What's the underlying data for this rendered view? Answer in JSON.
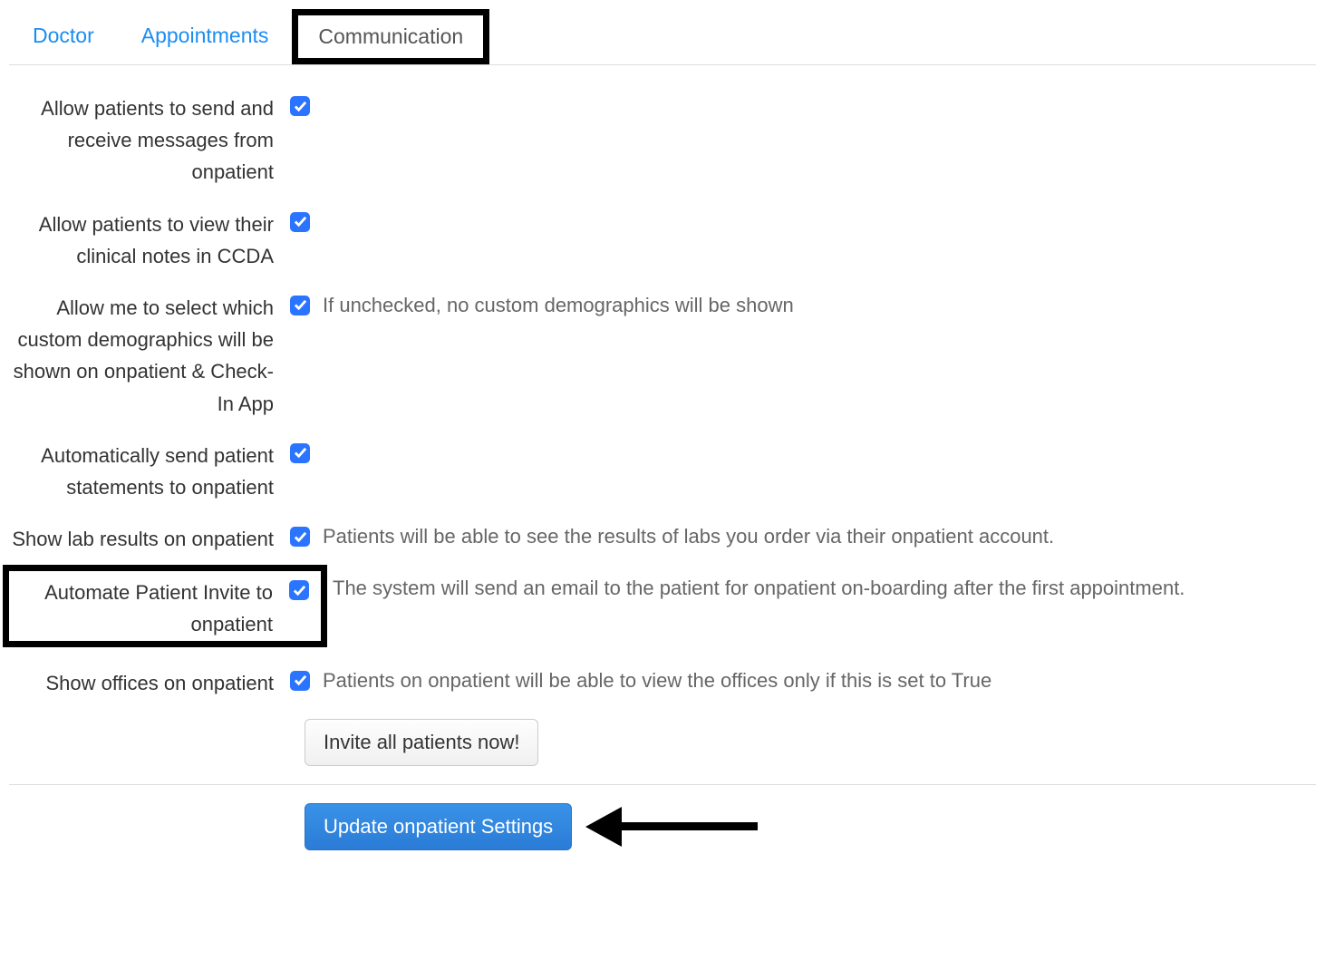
{
  "tabs": {
    "doctor": "Doctor",
    "appointments": "Appointments",
    "communication": "Communication"
  },
  "settings": {
    "allow_messages": {
      "label": "Allow patients to send and receive messages from onpatient",
      "checked": true
    },
    "allow_ccda": {
      "label": "Allow patients to view their clinical notes in CCDA",
      "checked": true
    },
    "custom_demographics": {
      "label": "Allow me to select which custom demographics will be shown on onpatient & Check-In App",
      "checked": true,
      "description": "If unchecked, no custom demographics will be shown"
    },
    "auto_statements": {
      "label": "Automatically send patient statements to onpatient",
      "checked": true
    },
    "lab_results": {
      "label": "Show lab results on onpatient",
      "checked": true,
      "description": "Patients will be able to see the results of labs you order via their onpatient account."
    },
    "automate_invite": {
      "label": "Automate Patient Invite to onpatient",
      "checked": true,
      "description": "The system will send an email to the patient for onpatient on-boarding after the first appointment."
    },
    "show_offices": {
      "label": "Show offices on onpatient",
      "checked": true,
      "description": "Patients on onpatient will be able to view the offices only if this is set to True"
    }
  },
  "buttons": {
    "invite_all": "Invite all patients now!",
    "update": "Update onpatient Settings"
  }
}
